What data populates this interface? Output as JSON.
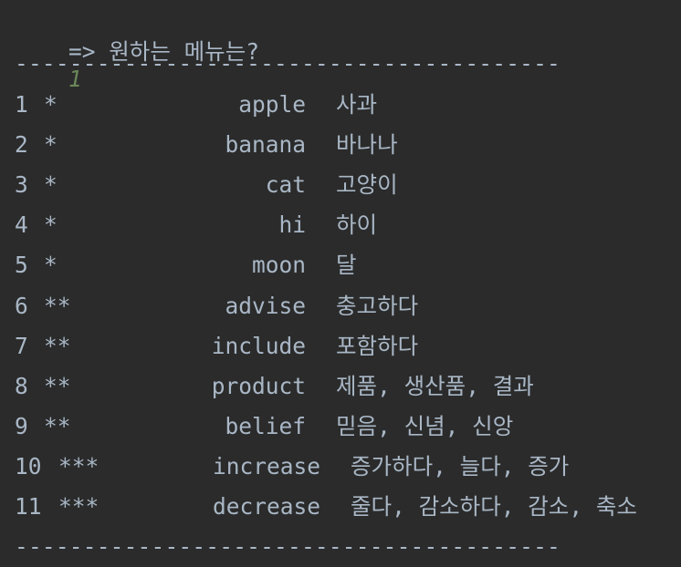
{
  "prompt": {
    "text": "=> 원하는 메뉴는?",
    "input": "1"
  },
  "separator": "----------------------------------------",
  "rows": [
    {
      "num": "1",
      "stars": "*",
      "word": "apple",
      "meaning": "사과"
    },
    {
      "num": "2",
      "stars": "*",
      "word": "banana",
      "meaning": "바나나"
    },
    {
      "num": "3",
      "stars": "*",
      "word": "cat",
      "meaning": "고양이"
    },
    {
      "num": "4",
      "stars": "*",
      "word": "hi",
      "meaning": "하이"
    },
    {
      "num": "5",
      "stars": "*",
      "word": "moon",
      "meaning": "달"
    },
    {
      "num": "6",
      "stars": "**",
      "word": "advise",
      "meaning": "충고하다"
    },
    {
      "num": "7",
      "stars": "**",
      "word": "include",
      "meaning": "포함하다"
    },
    {
      "num": "8",
      "stars": "**",
      "word": "product",
      "meaning": "제품, 생산품, 결과"
    },
    {
      "num": "9",
      "stars": "**",
      "word": "belief",
      "meaning": "믿음, 신념, 신앙"
    },
    {
      "num": "10",
      "stars": "***",
      "word": "increase",
      "meaning": "증가하다, 늘다, 증가"
    },
    {
      "num": "11",
      "stars": "***",
      "word": "decrease",
      "meaning": "줄다, 감소하다, 감소, 축소"
    }
  ],
  "colors": {
    "background": "#2b2b2b",
    "text": "#a9b7c6",
    "input": "#6a8759"
  }
}
